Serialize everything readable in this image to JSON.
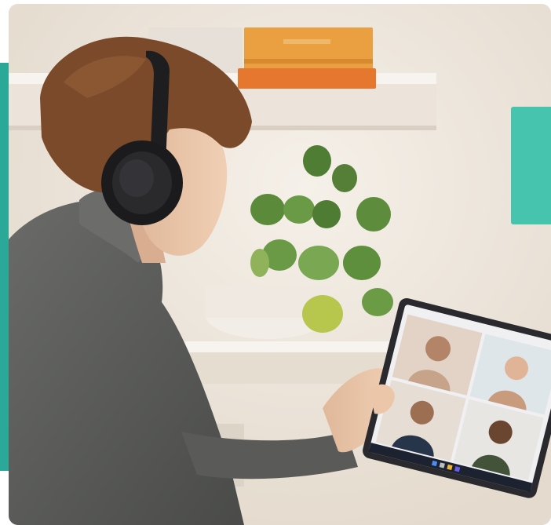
{
  "image": {
    "subject": "person-with-headphones-on-video-call",
    "colors": {
      "teal_left": "#2aa898",
      "teal_right": "#47c4ae",
      "wall": "#efe8df",
      "sweater": "#5d5e5c",
      "hair": "#7a4a2a",
      "headphones": "#1e1e20",
      "book_orange": "#e89436",
      "plant": "#5f8f3e",
      "tablet_frame": "#2a2a2e"
    },
    "icons": [
      "headphones-icon",
      "tablet-icon",
      "plant-icon"
    ]
  }
}
